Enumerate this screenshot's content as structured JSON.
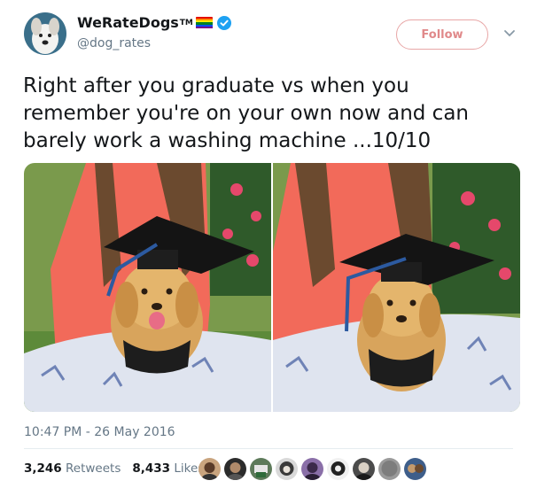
{
  "author": {
    "name": "WeRateDogs",
    "tm": "TM",
    "handle": "@dog_rates",
    "icons": [
      "rainbow-flag-icon",
      "verified-badge-icon"
    ]
  },
  "actions": {
    "follow_label": "Follow",
    "more_icon": "chevron-down-icon"
  },
  "tweet": {
    "text": "Right after you graduate vs when you remember you're on your own now and can barely work a washing machine ...10/10",
    "timestamp": "10:47 PM - 26 May 2016"
  },
  "stats": {
    "retweets_count": "3,246",
    "retweets_label": "Retweets",
    "likes_count": "8,433",
    "likes_label": "Likes"
  },
  "colors": {
    "accent_follow": "#e0898a",
    "verified": "#1da1f2",
    "text_muted": "#657786"
  }
}
